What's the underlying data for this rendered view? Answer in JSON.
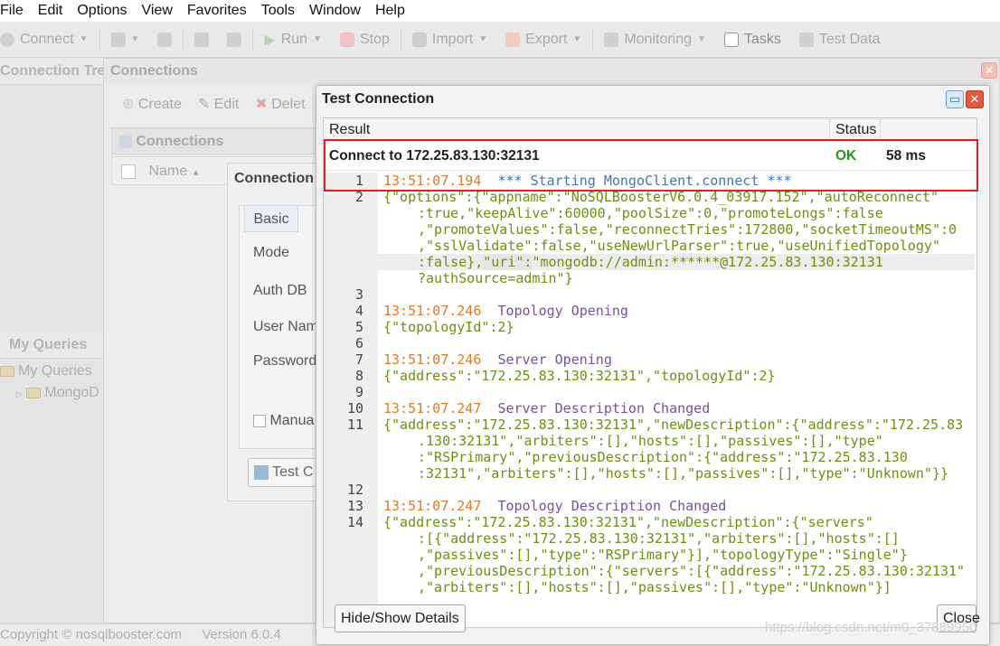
{
  "menu": [
    "File",
    "Edit",
    "Options",
    "View",
    "Favorites",
    "Tools",
    "Window",
    "Help"
  ],
  "toolbar": {
    "connect": "Connect",
    "run": "Run",
    "stop": "Stop",
    "import": "Import",
    "export": "Export",
    "monitoring": "Monitoring",
    "tasks": "Tasks",
    "test_data": "Test Data"
  },
  "left_pane": {
    "header": "Connection Tre",
    "queries_header": "My Queries",
    "tree": [
      "My Queries",
      "MongoD"
    ]
  },
  "connections_window": {
    "title": "Connections",
    "create": "Create",
    "edit": "Edit",
    "delete": "Delet",
    "list_header": "Connections",
    "col_name": "Name"
  },
  "editor": {
    "title": "Connection",
    "tab_basic": "Basic",
    "field_mode": "Mode",
    "field_authdb": "Auth DB",
    "field_user": "User Nam",
    "field_password": "Password",
    "manual": "Manua",
    "test_button": "Test C"
  },
  "dialog": {
    "title": "Test Connection",
    "col_result": "Result",
    "col_status": "Status",
    "row_result": "Connect to 172.25.83.130:32131",
    "row_status": "OK",
    "row_time": "58 ms",
    "hide_show": "Hide/Show Details",
    "close": "Close"
  },
  "log": {
    "l1_time": "13:51:07.194",
    "l1_msg": "*** Starting MongoClient.connect ***",
    "l2a": "{\"options\":{\"appname\":\"NoSQLBoosterV6.0.4_03917.152\",\"autoReconnect\"",
    "l2b": ":true,\"keepAlive\":60000,\"poolSize\":0,\"promoteLongs\":false",
    "l2c": ",\"promoteValues\":false,\"reconnectTries\":172800,\"socketTimeoutMS\":0",
    "l2d": ",\"sslValidate\":false,\"useNewUrlParser\":true,\"useUnifiedTopology\"",
    "l2e_a": ":false},",
    "l2e_b": "\"uri\":",
    "l2e_c": "\"mongodb://admin:******@172.25.83.130:32131",
    "l2f": "?authSource=admin\"}",
    "l4_time": "13:51:07.246",
    "l4_msg": "Topology Opening",
    "l5": "{\"topologyId\":2}",
    "l7_time": "13:51:07.246",
    "l7_msg": "Server Opening",
    "l8": "{\"address\":\"172.25.83.130:32131\",\"topologyId\":2}",
    "l10_time": "13:51:07.247",
    "l10_msg": "Server Description Changed",
    "l11a": "{\"address\":\"172.25.83.130:32131\",\"newDescription\":{\"address\":\"172.25.83",
    "l11b": ".130:32131\",\"arbiters\":[],\"hosts\":[],\"passives\":[],\"type\"",
    "l11c": ":\"RSPrimary\",\"previousDescription\":{\"address\":\"172.25.83.130",
    "l11d": ":32131\",\"arbiters\":[],\"hosts\":[],\"passives\":[],\"type\":\"Unknown\"}}",
    "l13_time": "13:51:07.247",
    "l13_msg": "Topology Description Changed",
    "l14a": "{\"address\":\"172.25.83.130:32131\",\"newDescription\":{\"servers\"",
    "l14b": ":[{\"address\":\"172.25.83.130:32131\",\"arbiters\":[],\"hosts\":[]",
    "l14c": ",\"passives\":[],\"type\":\"RSPrimary\"}],\"topologyType\":\"Single\"}",
    "l14d": ",\"previousDescription\":{\"servers\":[{\"address\":\"172.25.83.130:32131\"",
    "l14e": ",\"arbiters\":[],\"hosts\":[],\"passives\":[],\"type\":\"Unknown\"}]",
    "line_numbers": [
      "1",
      "2",
      "3",
      "4",
      "5",
      "6",
      "7",
      "8",
      "9",
      "10",
      "11",
      "12",
      "13",
      "14"
    ]
  },
  "statusbar": {
    "copyright": "Copyright ©  nosqlbooster.com",
    "version": "Version 6.0.4"
  },
  "watermark": "https://blog.csdn.net/m0_37889950",
  "colors": {
    "ok": "#1a9a1a",
    "highlight_border": "#e02020",
    "close_red": "#e05a3c"
  }
}
